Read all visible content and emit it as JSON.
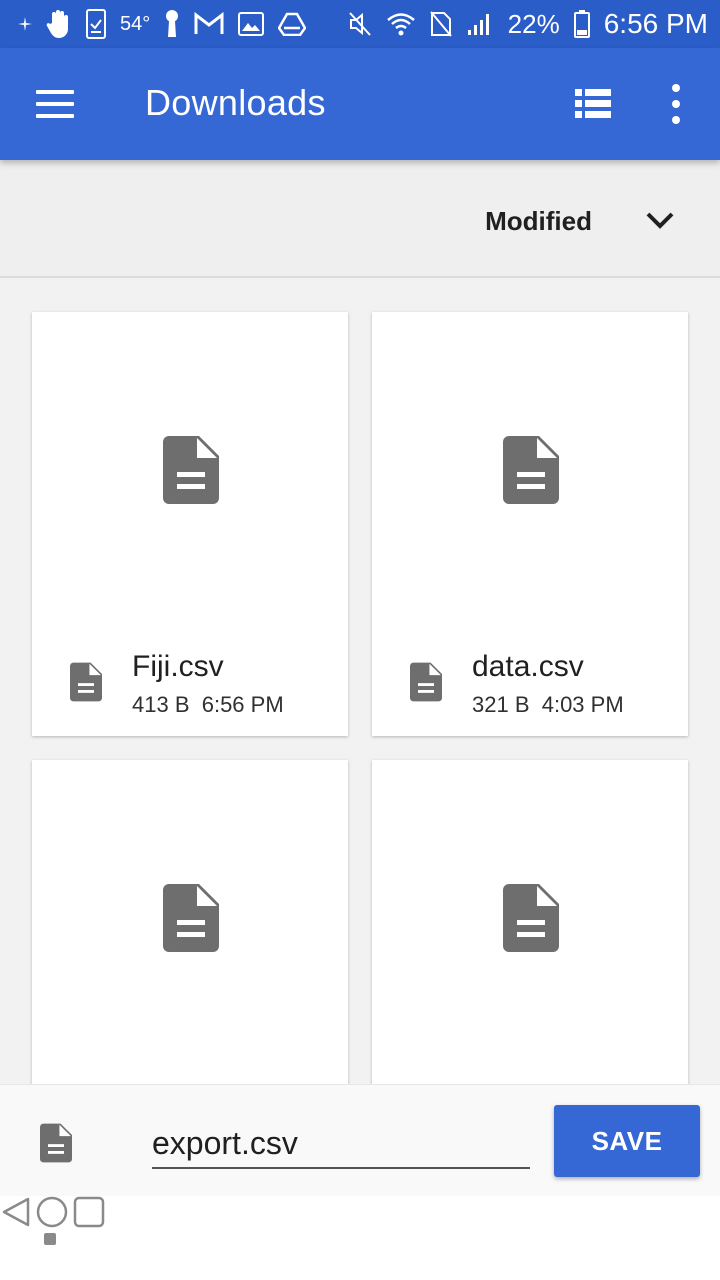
{
  "status_bar": {
    "temperature": "54°",
    "battery": "22%",
    "time": "6:56 PM",
    "icons": [
      "location-icon",
      "hand-icon",
      "checklist-icon",
      "thermometer-icon",
      "gmail-icon",
      "gallery-icon",
      "drive-icon",
      "mute-icon",
      "wifi-icon",
      "no-sim-icon",
      "signal-icon",
      "battery-icon"
    ]
  },
  "app_bar": {
    "title": "Downloads",
    "icons": [
      "menu-icon",
      "list-view-icon",
      "more-vert-icon"
    ]
  },
  "sort": {
    "label": "Modified",
    "icon": "chevron-down-icon"
  },
  "files": [
    {
      "name": "Fiji.csv",
      "size": "413 B",
      "time": "6:56 PM",
      "info": "413 B  6:56 PM"
    },
    {
      "name": "data.csv",
      "size": "321 B",
      "time": "4:03 PM",
      "info": "321 B  4:03 PM"
    },
    {
      "name": "",
      "info": ""
    },
    {
      "name": "",
      "info": ""
    }
  ],
  "save_bar": {
    "filename": "export.csv",
    "save_label": "SAVE"
  },
  "nav_bar": {
    "icons": [
      "recents-dot-icon",
      "back-icon",
      "home-icon",
      "overview-icon"
    ]
  },
  "colors": {
    "status_bar": "#2b5dc8",
    "app_bar": "#3568d4",
    "accent": "#3568d4",
    "file_icon": "#6e6e6e"
  }
}
